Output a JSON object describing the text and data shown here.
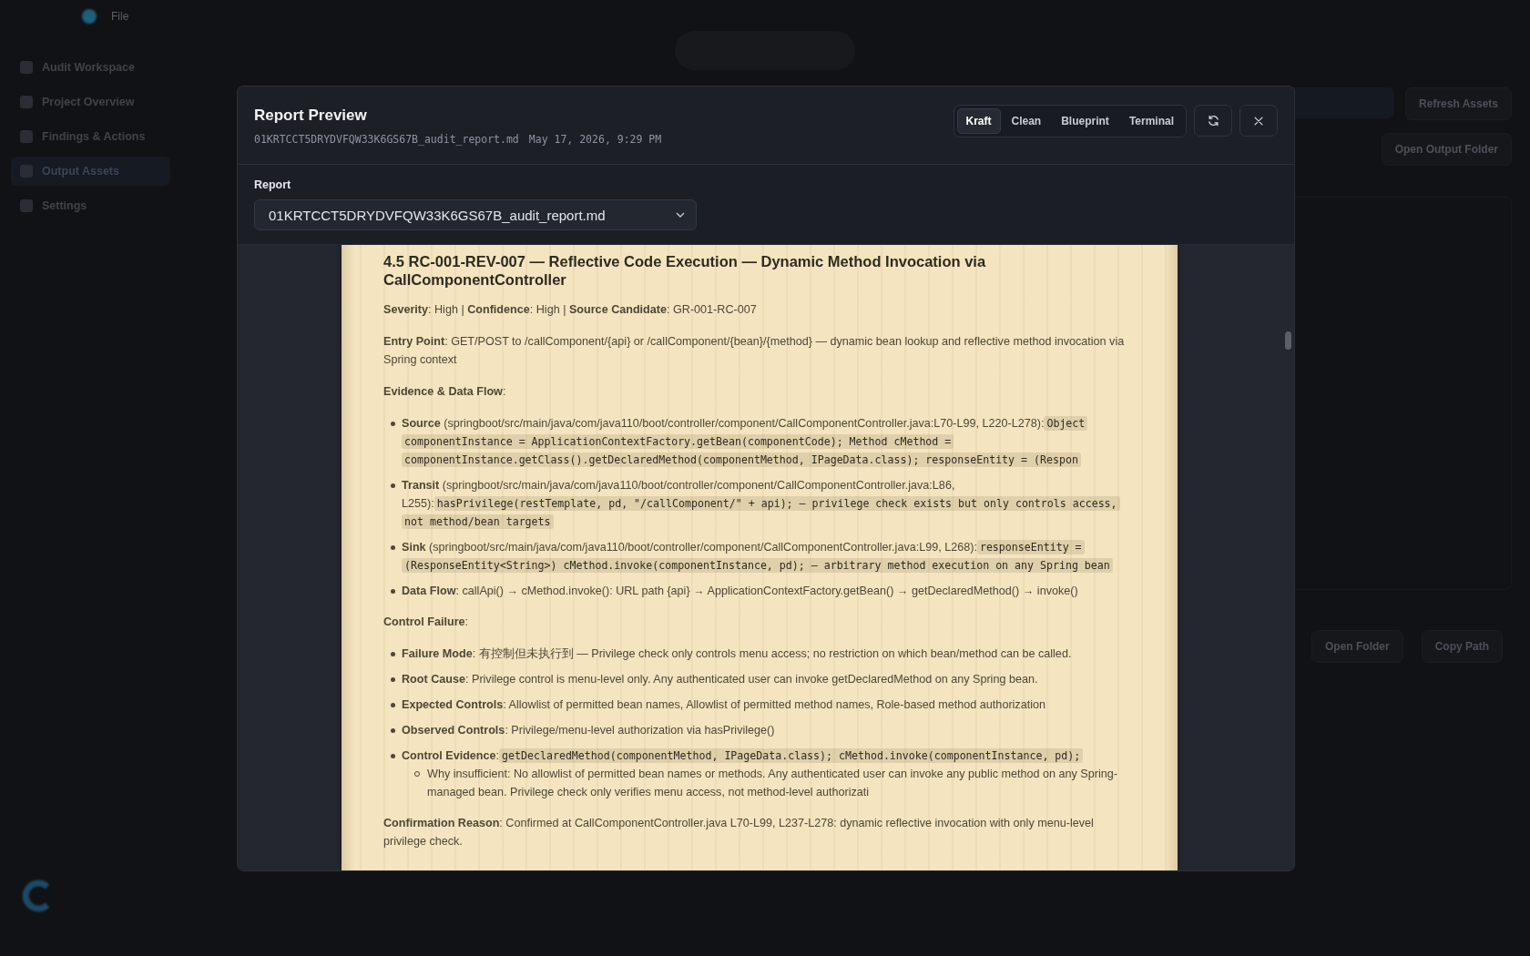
{
  "app": {
    "menu": "File",
    "sidebar": {
      "items": [
        {
          "label": "Audit Workspace",
          "selected": false
        },
        {
          "label": "Project Overview",
          "selected": false
        },
        {
          "label": "Findings & Actions",
          "selected": false
        },
        {
          "label": "Output Assets",
          "selected": true
        },
        {
          "label": "Settings",
          "selected": false
        }
      ]
    },
    "actions": [
      "Refresh Assets",
      "Open Output Folder"
    ],
    "file_actions": [
      "Open Folder",
      "Copy Path"
    ]
  },
  "modal": {
    "title": "Report Preview",
    "file": "01KRTCCT5DRYDVFQW33K6GS67B_audit_report.md",
    "date": "May 17, 2026, 9:29 PM",
    "themes": [
      {
        "label": "Kraft",
        "selected": true
      },
      {
        "label": "Clean",
        "selected": false
      },
      {
        "label": "Blueprint",
        "selected": false
      },
      {
        "label": "Terminal",
        "selected": false
      }
    ],
    "report_label": "Report",
    "report_value": "01KRTCCT5DRYDVFQW33K6GS67B_audit_report.md",
    "document": {
      "heading": "4.5 RC-001-REV-007 — Reflective Code Execution — Dynamic Method Invocation via CallComponentController",
      "blocks": [
        {
          "kind": "para",
          "text": "**Severity**: High | **Confidence**: High | **Source Candidate**: GR-001-RC-007"
        },
        {
          "kind": "para",
          "text": "**Entry Point**: GET/POST to /callComponent/{api} or /callComponent/{bean}/{method} — dynamic bean lookup and reflective method invocation via Spring context"
        },
        {
          "kind": "para",
          "text": "**Evidence & Data Flow**:"
        },
        {
          "kind": "list",
          "items": [
            {
              "text": "**Source** (springboot/src/main/java/com/java110/boot/controller/component/CallComponentController.java:L70-L99, L220-L278):",
              "code": "Object componentInstance = ApplicationContextFactory.getBean(componentCode); Method cMethod = componentInstance.getClass().getDeclaredMethod(componentMethod, IPageData.class); responseEntity = (Respon"
            },
            {
              "text": "**Transit** (springboot/src/main/java/com/java110/boot/controller/component/CallComponentController.java:L86, L255):",
              "code": "hasPrivilege(restTemplate, pd, \"/callComponent/\" + api); — privilege check exists but only controls access, not method/bean targets"
            },
            {
              "text": "**Sink** (springboot/src/main/java/com/java110/boot/controller/component/CallComponentController.java:L99, L268):",
              "code": "responseEntity = (ResponseEntity<String>) cMethod.invoke(componentInstance, pd); — arbitrary method execution on any Spring bean"
            },
            {
              "text": "**Data Flow**: callApi() → cMethod.invoke(): URL path {api} → ApplicationContextFactory.getBean() → getDeclaredMethod() → invoke()"
            }
          ]
        },
        {
          "kind": "para",
          "text": "**Control Failure**:"
        },
        {
          "kind": "list",
          "items": [
            {
              "text": "**Failure Mode**: 有控制但未执行到 — Privilege check only controls menu access; no restriction on which bean/method can be called."
            },
            {
              "text": "**Root Cause**: Privilege control is menu-level only. Any authenticated user can invoke getDeclaredMethod on any Spring bean."
            },
            {
              "text": "**Expected Controls**: Allowlist of permitted bean names, Allowlist of permitted method names, Role-based method authorization"
            },
            {
              "text": "**Observed Controls**: Privilege/menu-level authorization via hasPrivilege()"
            },
            {
              "text": "**Control Evidence**:",
              "code": "getDeclaredMethod(componentMethod, IPageData.class); cMethod.invoke(componentInstance, pd);",
              "sub": [
                "Why insufficient: No allowlist of permitted bean names or methods. Any authenticated user can invoke any public method on any Spring-managed bean. Privilege check only verifies menu access, not method-level authorizati"
              ]
            }
          ]
        },
        {
          "kind": "para",
          "text": "**Confirmation Reason**: Confirmed at CallComponentController.java L70-L99, L237-L278: dynamic reflective invocation with only menu-level privilege check."
        }
      ]
    }
  }
}
